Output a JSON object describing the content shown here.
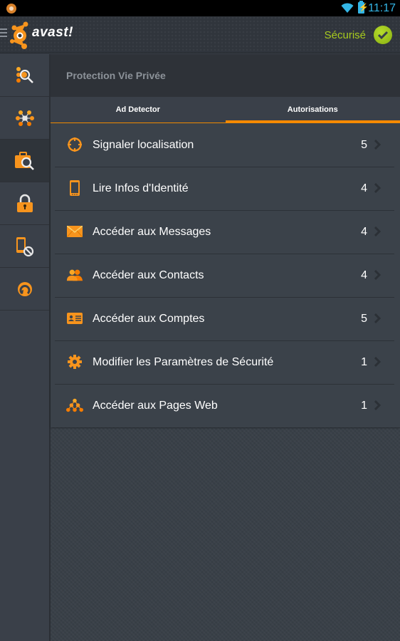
{
  "status_bar": {
    "time": "11:17",
    "battery_glyph": "⚡"
  },
  "app_bar": {
    "brand": "avast!",
    "status_label": "Sécurisé",
    "status_color": "#a8cc1e"
  },
  "sidebar": {
    "items": [
      {
        "icon": "scan-icon",
        "active": false
      },
      {
        "icon": "network-icon",
        "active": false
      },
      {
        "icon": "privacy-advisor-icon",
        "active": true
      },
      {
        "icon": "app-locker-icon",
        "active": false
      },
      {
        "icon": "call-filter-icon",
        "active": false
      },
      {
        "icon": "backup-icon",
        "active": false
      }
    ]
  },
  "main": {
    "section_title": "Protection Vie Privée",
    "tabs": [
      {
        "label": "Ad Detector",
        "active": false
      },
      {
        "label": "Autorisations",
        "active": true
      }
    ],
    "permissions": [
      {
        "icon": "location-target-icon",
        "label": "Signaler localisation",
        "count": "5"
      },
      {
        "icon": "phone-icon",
        "label": "Lire Infos d'Identité",
        "count": "4"
      },
      {
        "icon": "envelope-icon",
        "label": "Accéder aux Messages",
        "count": "4"
      },
      {
        "icon": "contacts-icon",
        "label": "Accéder aux Contacts",
        "count": "4"
      },
      {
        "icon": "account-card-icon",
        "label": "Accéder aux Comptes",
        "count": "5"
      },
      {
        "icon": "gear-icon",
        "label": "Modifier les Paramètres de Sécurité",
        "count": "1"
      },
      {
        "icon": "web-pages-icon",
        "label": "Accéder aux Pages Web",
        "count": "1"
      }
    ]
  },
  "colors": {
    "accent": "#f88a00",
    "secure_green": "#a8cc1e",
    "status_blue": "#33b5e5"
  }
}
